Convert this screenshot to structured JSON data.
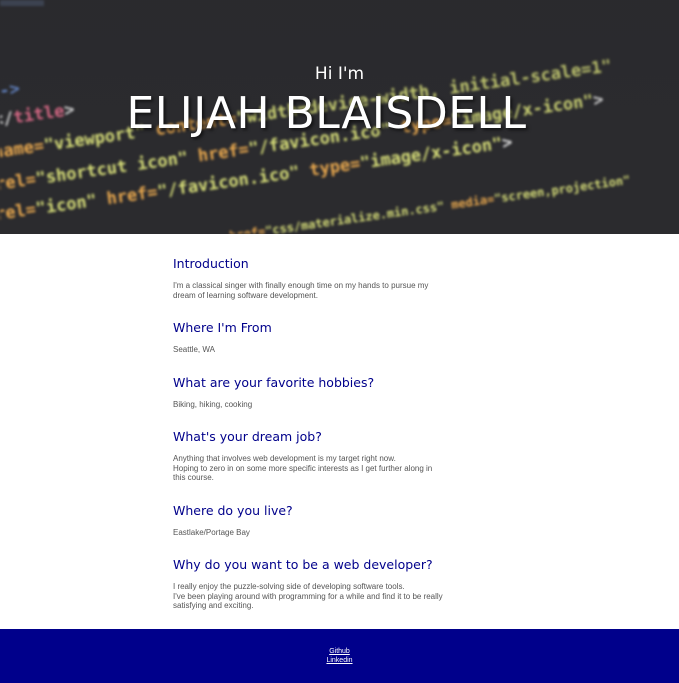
{
  "hero": {
    "greeting": "Hi I'm",
    "name": "ELIJAH BLAISDELL"
  },
  "sections": [
    {
      "question": "Introduction",
      "answer": "I'm a classical singer with finally enough time on my hands to pursue my\ndream of learning software development."
    },
    {
      "question": "Where I'm From",
      "answer": "Seattle, WA"
    },
    {
      "question": "What are your favorite hobbies?",
      "answer": "Biking, hiking, cooking"
    },
    {
      "question": "What's your dream job?",
      "answer": "Anything that involves web development is my target right now.\nHoping to zero in on some more specific interests as I get further along in\nthis course."
    },
    {
      "question": "Where do you live?",
      "answer": "Eastlake/Portage Bay"
    },
    {
      "question": "Why do you want to be a web developer?",
      "answer": "I really enjoy the puzzle-solving side of developing software tools.\nI've been playing around with programming for a while and find it to be really\nsatisfying and exciting."
    }
  ],
  "footer": {
    "links": [
      "Github",
      "Linkedin"
    ]
  },
  "colors": {
    "heading": "#00008b",
    "footer_bg": "#00008b",
    "hero_bg": "#2b2b2e"
  }
}
